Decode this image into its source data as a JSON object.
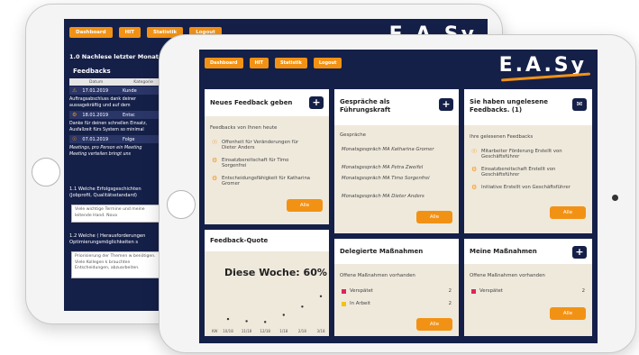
{
  "brand": {
    "logo": "E.A.Sy"
  },
  "nav": [
    "Dashboard",
    "HIT",
    "Statistik",
    "Logout"
  ],
  "back_screen": {
    "heading": "1.0 Nachlese letzter Monat",
    "feedbacks_title": "Feedbacks",
    "columns": [
      "Datum",
      "Kategorie"
    ],
    "rows": [
      {
        "date": "17.01.2019",
        "category": "Kunde"
      },
      {
        "date": "18.01.2019",
        "category": "Entsc"
      },
      {
        "date": "07.01.2019",
        "category": "Folge"
      }
    ],
    "texts": [
      "Auftragsabschluss dank deiner aussagekräftig und auf dem",
      "Danke für deinen schnellen Einsatz, Ausfallzeit fürs System so minimal",
      "Meetings, pro Person ein Meeting Meeting verteilen bringt uns"
    ],
    "questions": [
      "1.1 Welche Erfolgsgeschichten (Jobprofil, Qualitätsstandard)",
      "1.2 Welche ( Herausforderungen Optimierungsmöglichkeiten s"
    ],
    "answers": [
      "Viele wichtige Termine und meine leitende Hand. Nova",
      "Priorisierung der Themen w benötigen. Viele Kollegen k brauchten Entscheidungen, abzuarbeiten."
    ]
  },
  "cards": {
    "feedback": {
      "title": "Neues Feedback geben",
      "subtitle": "Feedbacks von Ihnen heute",
      "items": [
        {
          "icon": "lightbulb-icon",
          "text": "Offenheit für Veränderungen für Dieter Anders"
        },
        {
          "icon": "gear-icon",
          "text": "Einsatzbereitschaft für Timo Sorgenfrei"
        },
        {
          "icon": "gear-icon",
          "text": "Entscheidungsfähigkeit für Katharina Gromer"
        }
      ],
      "button": "Alle"
    },
    "gespraeche": {
      "title": "Gespräche als Führungskraft",
      "subtitle": "Gespräche",
      "links": [
        "Monatsgespräch MA Katharina Gromer",
        "Monatsgespräch MA Petra Zweifel",
        "Monatsgespräch MA Timo Sorgenfrei",
        "Monatsgespräch MA Dieter Anders"
      ],
      "button": "Alle"
    },
    "unread": {
      "title": "Sie haben ungelesene Feedbacks. (1)",
      "subtitle": "Ihre gelesenen Feedbacks",
      "items": [
        {
          "icon": "lightbulb-icon",
          "text": "Mitarbeiter Förderung Erstellt von Geschäftsführer"
        },
        {
          "icon": "gear-icon",
          "text": "Einsatzbereitschaft Erstellt von Geschäftsführer"
        },
        {
          "icon": "gear-icon",
          "text": "Initiative Erstellt von Geschäftsführer"
        }
      ],
      "button": "Alle"
    },
    "quote": {
      "title": "Feedback-Quote",
      "value_label": "Diese Woche: 60%",
      "x_labels": [
        "KW",
        "10/18",
        "11/18",
        "12/18",
        "1/18",
        "2/18",
        "3/18"
      ]
    },
    "delegated": {
      "title": "Delegierte Maßnahmen",
      "subtitle": "Offene Maßnahmen vorhanden",
      "rows": [
        {
          "label": "Verspätet",
          "count": "2",
          "color": "#e0245a"
        },
        {
          "label": "In Arbeit",
          "count": "2",
          "color": "#f2c315"
        }
      ],
      "button": "Alle"
    },
    "measures": {
      "title": "Meine Maßnahmen",
      "subtitle": "Offene Maßnahmen vorhanden",
      "rows": [
        {
          "label": "Verspätet",
          "count": "2",
          "color": "#e0245a"
        }
      ],
      "button": "Alle"
    }
  },
  "chart_data": {
    "type": "scatter",
    "title": "Diese Woche: 60%",
    "x": [
      "10/18",
      "11/18",
      "12/18",
      "1/18",
      "2/18",
      "3/18"
    ],
    "y": [
      0.15,
      0.1,
      0.08,
      0.25,
      0.45,
      0.7
    ],
    "ylim": [
      0,
      1
    ]
  }
}
